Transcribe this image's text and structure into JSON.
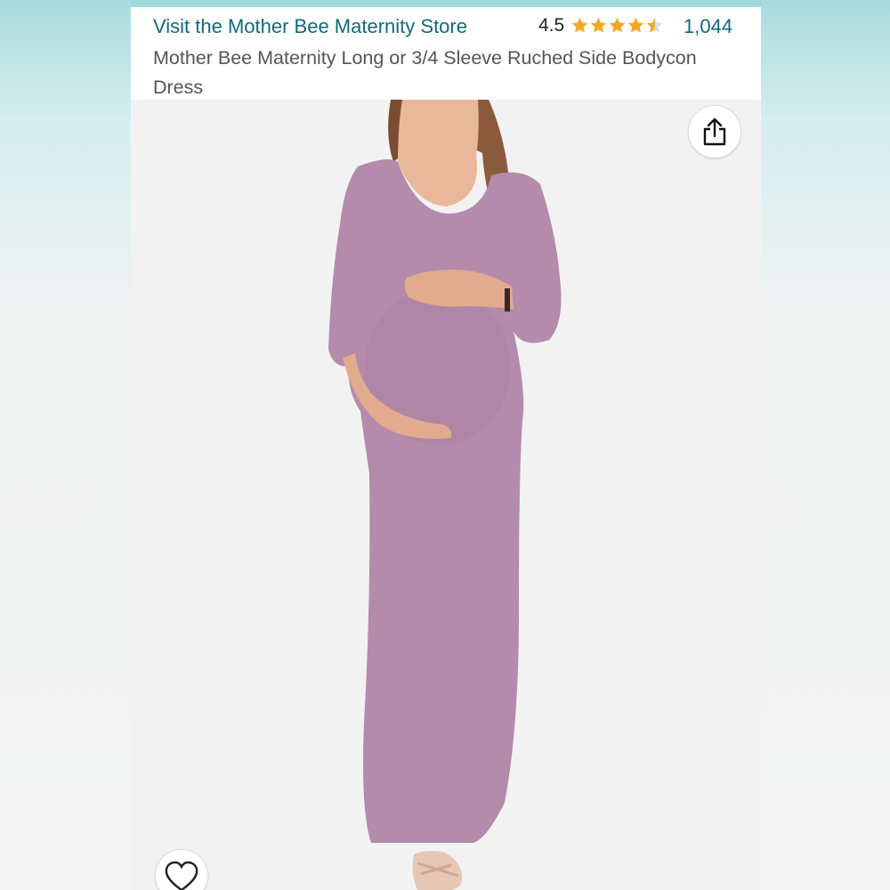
{
  "listing": {
    "store_link": "Visit the Mother Bee Maternity Store",
    "rating_value": "4.5",
    "rating_stars": 4.5,
    "review_count": "1,044",
    "title": "Mother Bee Maternity Long or 3/4 Sleeve Ruched Side Bodycon Dress"
  },
  "icons": {
    "share": "share-icon",
    "wishlist": "heart-icon",
    "star": "star-icon"
  },
  "colors": {
    "link": "#0f6a7c",
    "star": "#f5a623",
    "dress": "#b48bab"
  },
  "image": {
    "alt": "pregnant woman wearing mauve 3/4 sleeve maxi dress"
  }
}
